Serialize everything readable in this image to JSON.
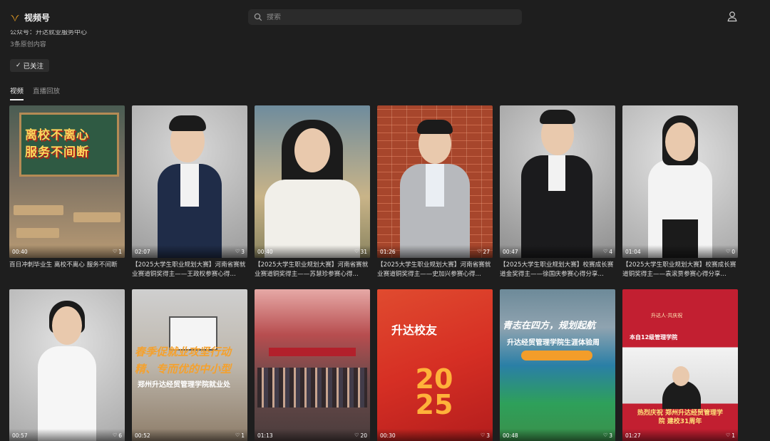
{
  "header": {
    "app_name": "视频号",
    "search_placeholder": "搜索",
    "brand_color": "#f5a623"
  },
  "profile": {
    "account_line": "公众号：升达就业服务中心",
    "original_count": "3条原创内容",
    "follow_label": "已关注"
  },
  "tabs": [
    {
      "label": "视频",
      "active": true
    },
    {
      "label": "直播回放",
      "active": false
    }
  ],
  "videos": [
    {
      "duration": "00:40",
      "likes": "1",
      "caption": "百日冲刺毕业生 离校不离心 服务不间断",
      "cover_text": [
        "离校不离心",
        "服务不间断"
      ]
    },
    {
      "duration": "02:07",
      "likes": "3",
      "caption": "【2025大学生职业规划大赛】河南省赛就业赛道铜奖得主——王政权参赛心得..."
    },
    {
      "duration": "00:40",
      "likes": "31",
      "caption": "【2025大学生职业规划大赛】河南省赛就业赛道铜奖得主——苏慧珍参赛心得..."
    },
    {
      "duration": "01:26",
      "likes": "27",
      "caption": "【2025大学生职业规划大赛】河南省赛就业赛道铜奖得主——史加兴参赛心得..."
    },
    {
      "duration": "00:47",
      "likes": "4",
      "caption": "【2025大学生职业规划大赛】校赛成长赛道金奖得主——徐国庆参赛心得分享..."
    },
    {
      "duration": "01:04",
      "likes": "0",
      "caption": "【2025大学生职业规划大赛】校赛成长赛道铜奖得主——袁滚贾参赛心得分享..."
    },
    {
      "duration": "00:57",
      "likes": "6",
      "caption": ""
    },
    {
      "duration": "00:52",
      "likes": "1",
      "caption": "",
      "cover_text": [
        "春季促就业攻坚行动",
        "精、专而优的中小型",
        "郑州升达经贸管理学院就业处"
      ]
    },
    {
      "duration": "01:13",
      "likes": "20",
      "caption": ""
    },
    {
      "duration": "00:30",
      "likes": "3",
      "caption": "",
      "cover_text": [
        "升达校友",
        "2025"
      ]
    },
    {
      "duration": "00:48",
      "likes": "3",
      "caption": "",
      "cover_text": [
        "青志在四方，规划起航",
        "升达经贸管理学院生涯体验周"
      ]
    },
    {
      "duration": "01:27",
      "likes": "1",
      "caption": "",
      "cover_text": [
        "升达人·共庆祝",
        "本自12级管理学院",
        "热烈庆祝 郑州升达经贸管理学院 建校31周年"
      ]
    }
  ]
}
